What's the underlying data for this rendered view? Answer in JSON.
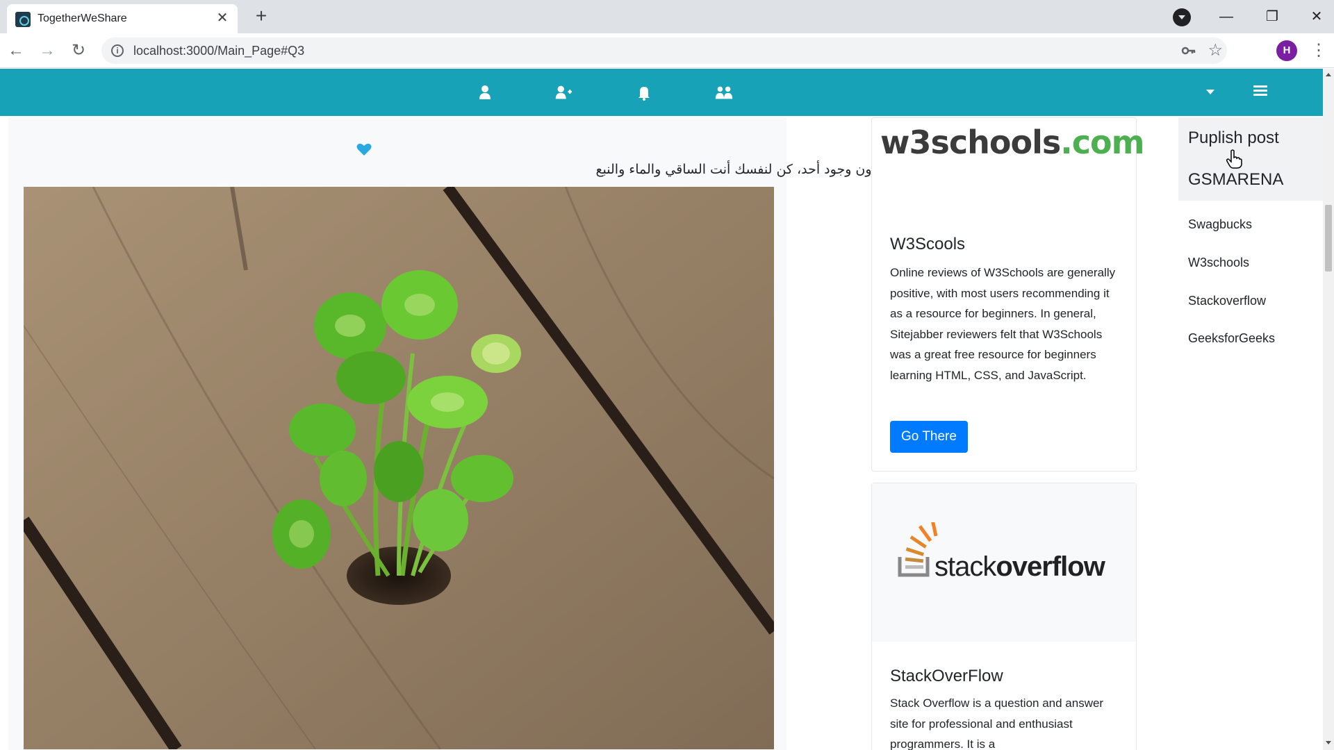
{
  "browser": {
    "tab_title": "TogetherWeShare",
    "url": "localhost:3000/Main_Page#Q3",
    "avatar_initial": "H"
  },
  "navbar": {
    "color": "#17a2b8",
    "icons": [
      "user-icon",
      "user-plus-icon",
      "bell-icon",
      "users-icon",
      "caret-down-icon",
      "hamburger-menu-icon"
    ]
  },
  "post": {
    "text": "أزهر دون وجود أحد، كن لنفسك أنت الساقي والماء والنبع",
    "icon": "blue-heart-icon"
  },
  "ads": [
    {
      "logo_main": "w3schools",
      "logo_accent": ".com",
      "title": "W3Scools",
      "description": "Online reviews of W3Schools are generally positive, with most users recommending it as a resource for beginners. In general, Sitejabber reviewers felt that W3Schools was a great free resource for beginners learning HTML, CSS, and JavaScript.",
      "button": "Go There"
    },
    {
      "logo_main": "stack",
      "logo_accent": "overflow",
      "title": "StackOverFlow",
      "description": "Stack Overflow is a question and answer site for professional and enthusiast programmers. It is a"
    }
  ],
  "dropdown": {
    "items": [
      "Puplish post",
      "GSMARENA",
      "Swagbucks",
      "W3schools",
      "Stackoverflow",
      "GeeksforGeeks"
    ]
  }
}
